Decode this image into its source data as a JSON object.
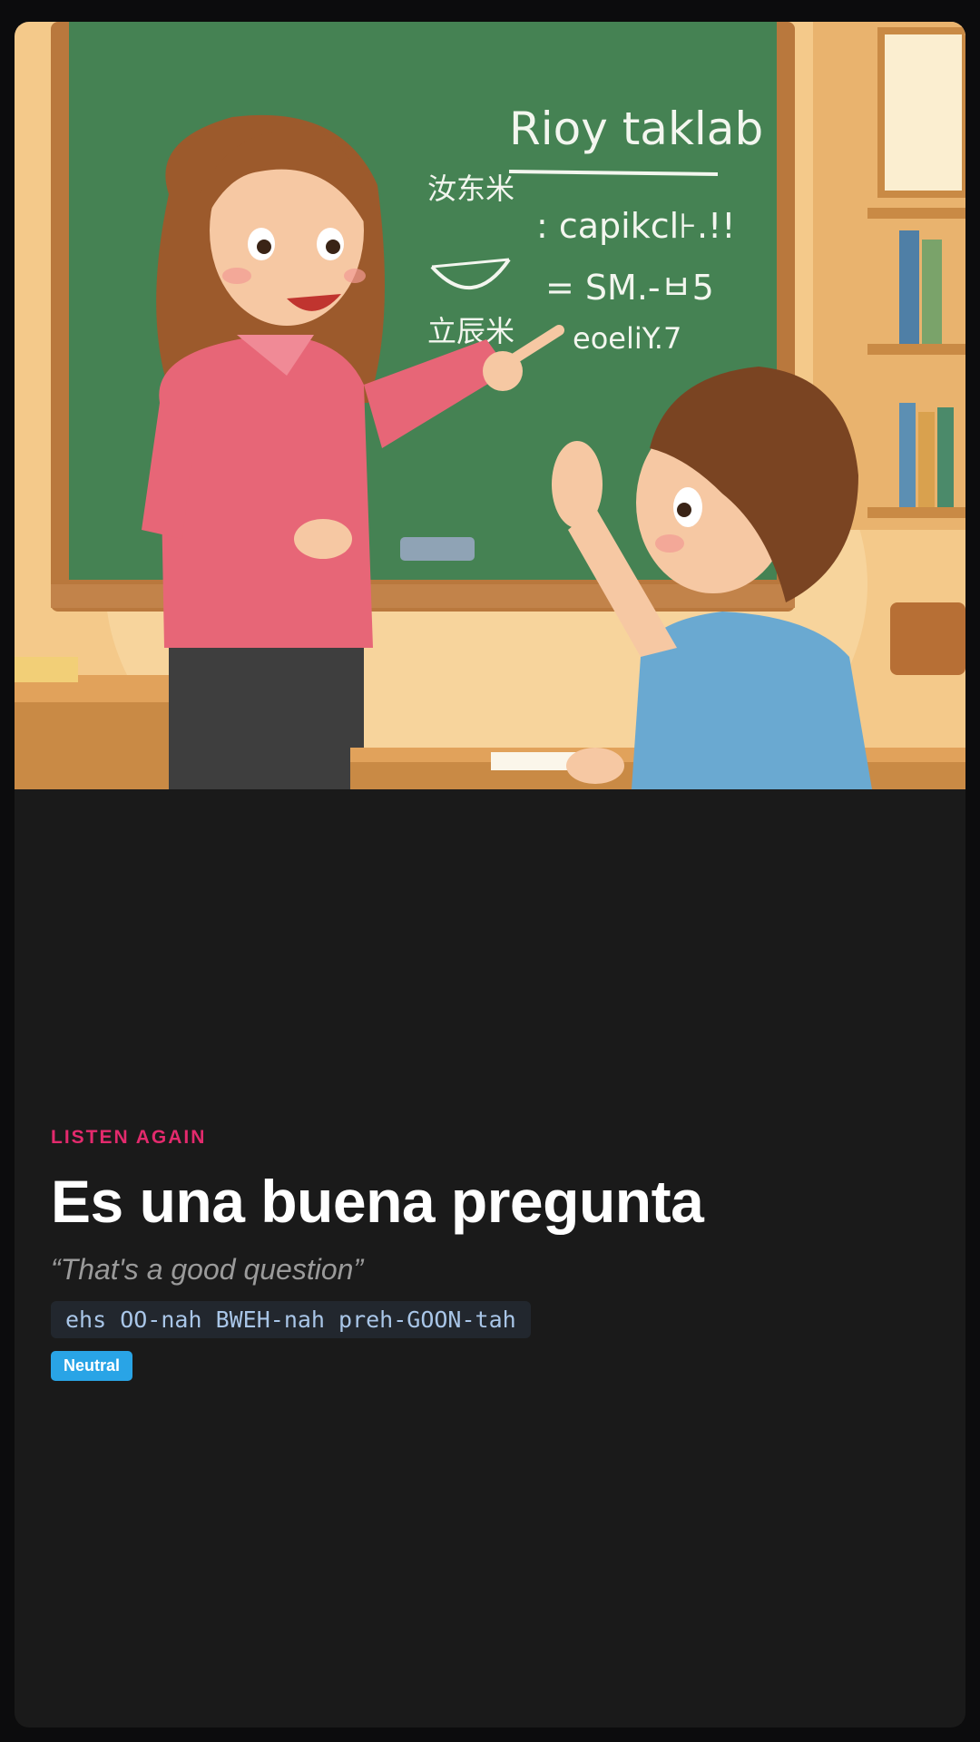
{
  "colors": {
    "page_background": "#0c0c0d",
    "card_background": "#1a1a1a",
    "eyebrow": "#e32a6d",
    "badge": "#29a4e6",
    "pronunciation_bg": "#22272e",
    "pronunciation_text": "#a9c6e8"
  },
  "illustration": {
    "subject": "cartoon classroom: teacher pointing at chalkboard, student raising hand",
    "board_title": "Rioy taklab",
    "board_lines": [
      ": capikcl⊦.!!",
      "= SM.-ㅂ5",
      "eoeliY.7"
    ],
    "board_symbols": [
      "汝东米",
      "立辰米"
    ]
  },
  "phrase_card": {
    "eyebrow": "LISTEN AGAIN",
    "phrase": "Es una buena pregunta",
    "translation": "“That's a good question”",
    "pronunciation": "ehs OO-nah BWEH-nah preh-GOON-tah",
    "badge": "Neutral"
  }
}
